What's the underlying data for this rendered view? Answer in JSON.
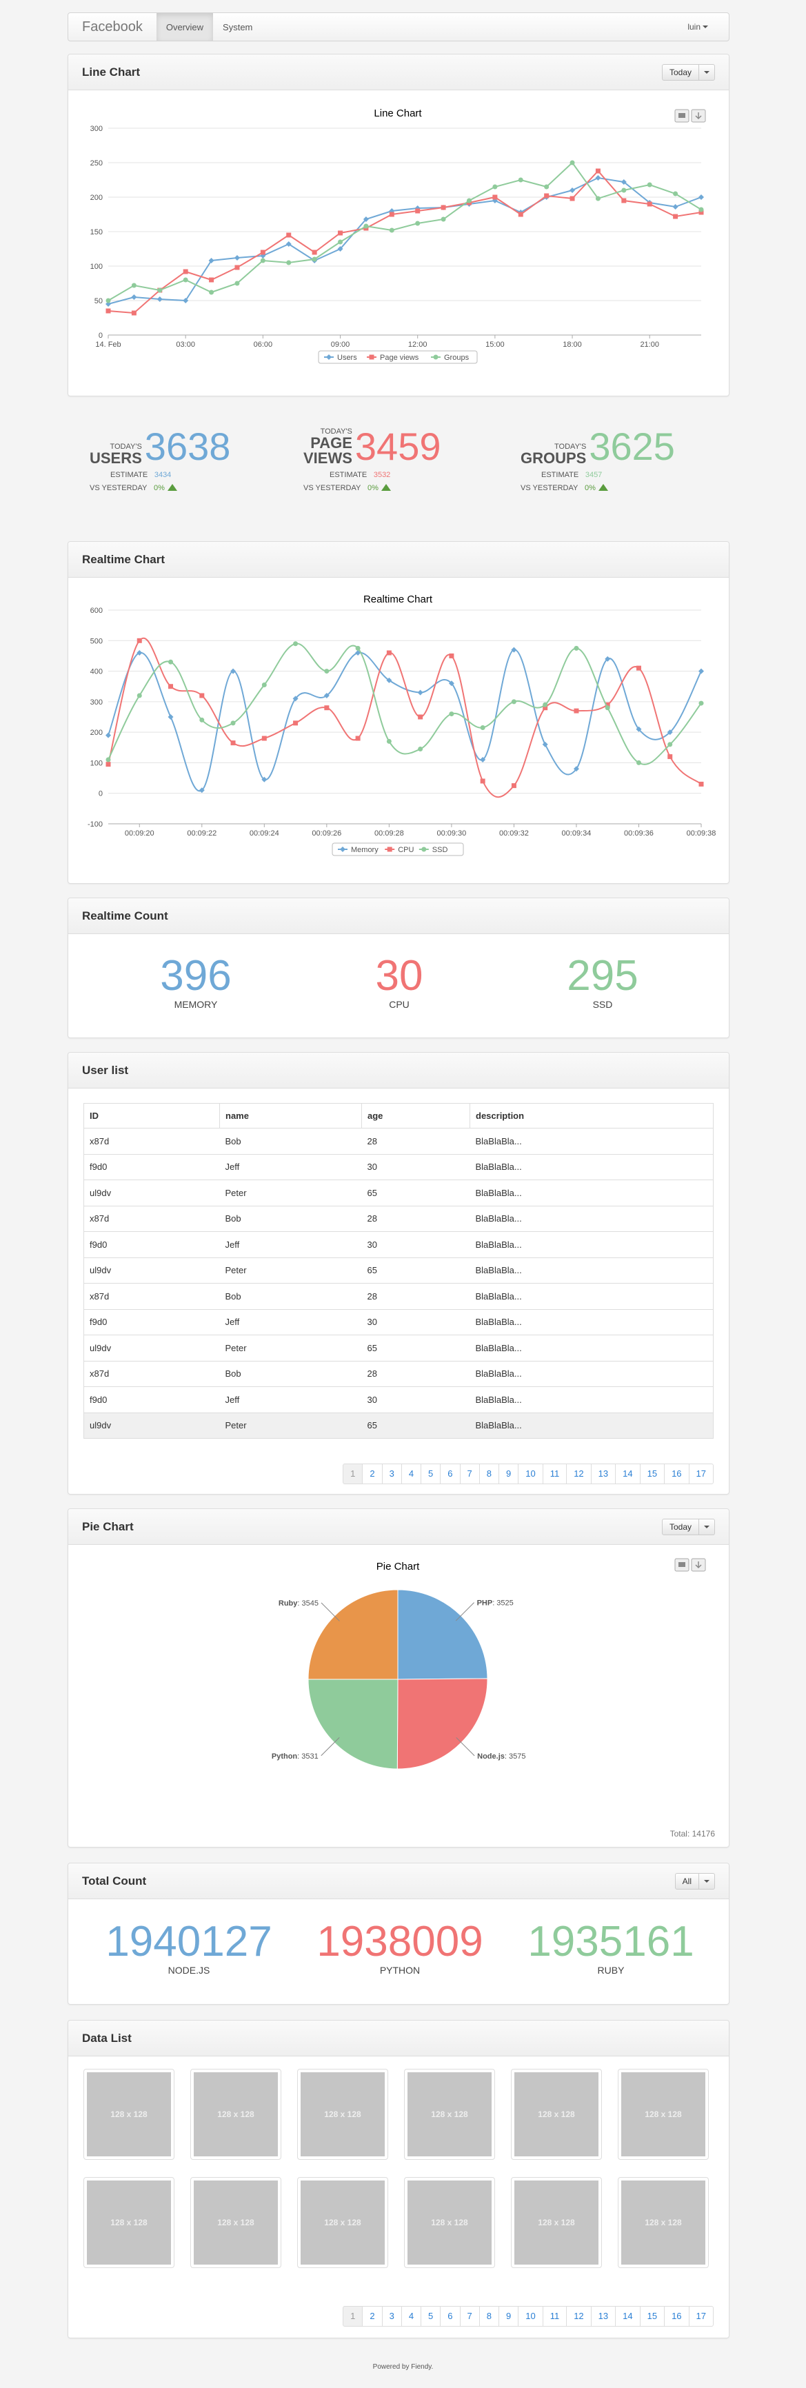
{
  "navbar": {
    "brand": "Facebook",
    "tabs": [
      "Overview",
      "System"
    ],
    "user": "luin"
  },
  "line_panel": {
    "title": "Line Chart",
    "button": "Today"
  },
  "stats": [
    {
      "today": "TODAY'S",
      "label": "USERS",
      "value": "3638",
      "estimate_label": "ESTIMATE",
      "estimate": "3434",
      "vs_label": "VS YESTERDAY",
      "pct": "0%",
      "color": "#6fa8d6"
    },
    {
      "today": "TODAY'S",
      "label": "PAGE VIEWS",
      "value": "3459",
      "estimate_label": "ESTIMATE",
      "estimate": "3532",
      "vs_label": "VS YESTERDAY",
      "pct": "0%",
      "color": "#f07474"
    },
    {
      "today": "TODAY'S",
      "label": "GROUPS",
      "value": "3625",
      "estimate_label": "ESTIMATE",
      "estimate": "3457",
      "vs_label": "VS YESTERDAY",
      "pct": "0%",
      "color": "#8fcb9b"
    }
  ],
  "realtime_panel": {
    "title": "Realtime Chart"
  },
  "realtime_count": {
    "title": "Realtime Count",
    "items": [
      {
        "value": "396",
        "label": "MEMORY",
        "color": "#6fa8d6"
      },
      {
        "value": "30",
        "label": "CPU",
        "color": "#f07474"
      },
      {
        "value": "295",
        "label": "SSD",
        "color": "#8fcb9b"
      }
    ]
  },
  "user_list": {
    "title": "User list",
    "columns": [
      "ID",
      "name",
      "age",
      "description"
    ],
    "rows": [
      [
        "x87d",
        "Bob",
        "28",
        "BlaBlaBla..."
      ],
      [
        "f9d0",
        "Jeff",
        "30",
        "BlaBlaBla..."
      ],
      [
        "ul9dv",
        "Peter",
        "65",
        "BlaBlaBla..."
      ],
      [
        "x87d",
        "Bob",
        "28",
        "BlaBlaBla..."
      ],
      [
        "f9d0",
        "Jeff",
        "30",
        "BlaBlaBla..."
      ],
      [
        "ul9dv",
        "Peter",
        "65",
        "BlaBlaBla..."
      ],
      [
        "x87d",
        "Bob",
        "28",
        "BlaBlaBla..."
      ],
      [
        "f9d0",
        "Jeff",
        "30",
        "BlaBlaBla..."
      ],
      [
        "ul9dv",
        "Peter",
        "65",
        "BlaBlaBla..."
      ],
      [
        "x87d",
        "Bob",
        "28",
        "BlaBlaBla..."
      ],
      [
        "f9d0",
        "Jeff",
        "30",
        "BlaBlaBla..."
      ],
      [
        "ul9dv",
        "Peter",
        "65",
        "BlaBlaBla..."
      ]
    ],
    "pages": [
      "1",
      "2",
      "3",
      "4",
      "5",
      "6",
      "7",
      "8",
      "9",
      "10",
      "11",
      "12",
      "13",
      "14",
      "15",
      "16",
      "17"
    ]
  },
  "pie_panel": {
    "title": "Pie Chart",
    "button": "Today",
    "total": "Total: 14176"
  },
  "total_count": {
    "title": "Total Count",
    "button": "All",
    "items": [
      {
        "value": "1940127",
        "label": "NODE.JS",
        "color": "#6fa8d6"
      },
      {
        "value": "1938009",
        "label": "PYTHON",
        "color": "#f07474"
      },
      {
        "value": "1935161",
        "label": "RUBY",
        "color": "#8fcb9b"
      }
    ]
  },
  "data_list": {
    "title": "Data List",
    "thumb_label": "128 x 128",
    "pages": [
      "1",
      "2",
      "3",
      "4",
      "5",
      "6",
      "7",
      "8",
      "9",
      "10",
      "11",
      "12",
      "13",
      "14",
      "15",
      "16",
      "17"
    ]
  },
  "footer": "Powered by Fiendy.",
  "chart_data": [
    {
      "type": "line",
      "title": "Line Chart",
      "x": [
        "14. Feb",
        "01:00",
        "02:00",
        "03:00",
        "04:00",
        "05:00",
        "06:00",
        "07:00",
        "08:00",
        "09:00",
        "10:00",
        "11:00",
        "12:00",
        "13:00",
        "14:00",
        "15:00",
        "16:00",
        "17:00",
        "18:00",
        "19:00",
        "20:00",
        "21:00",
        "22:00",
        "23:00"
      ],
      "xticks": [
        "14. Feb",
        "03:00",
        "06:00",
        "09:00",
        "12:00",
        "15:00",
        "18:00",
        "21:00"
      ],
      "ylim": [
        0,
        300
      ],
      "yticks": [
        0,
        50,
        100,
        150,
        200,
        250,
        300
      ],
      "series": [
        {
          "name": "Users",
          "color": "#6fa8d6",
          "values": [
            45,
            55,
            52,
            50,
            108,
            112,
            115,
            132,
            108,
            125,
            168,
            180,
            184,
            185,
            190,
            195,
            178,
            200,
            210,
            228,
            222,
            192,
            186,
            200
          ]
        },
        {
          "name": "Page views",
          "color": "#f07474",
          "values": [
            35,
            32,
            65,
            92,
            80,
            98,
            120,
            145,
            120,
            148,
            155,
            175,
            180,
            185,
            192,
            200,
            175,
            202,
            198,
            238,
            195,
            190,
            172,
            178
          ]
        },
        {
          "name": "Groups",
          "color": "#8fcb9b",
          "values": [
            50,
            72,
            65,
            80,
            62,
            75,
            108,
            105,
            110,
            135,
            158,
            152,
            162,
            168,
            195,
            215,
            225,
            215,
            250,
            198,
            210,
            218,
            205,
            182
          ]
        }
      ],
      "legend": "bottom-center"
    },
    {
      "type": "line",
      "title": "Realtime Chart",
      "x": [
        "00:09:19",
        "00:09:20",
        "00:09:21",
        "00:09:22",
        "00:09:23",
        "00:09:24",
        "00:09:25",
        "00:09:26",
        "00:09:27",
        "00:09:28",
        "00:09:29",
        "00:09:30",
        "00:09:31",
        "00:09:32",
        "00:09:33",
        "00:09:34",
        "00:09:35",
        "00:09:36",
        "00:09:37",
        "00:09:38"
      ],
      "xticks": [
        "00:09:20",
        "00:09:22",
        "00:09:24",
        "00:09:26",
        "00:09:28",
        "00:09:30",
        "00:09:32",
        "00:09:34",
        "00:09:36",
        "00:09:38"
      ],
      "ylim": [
        -100,
        600
      ],
      "yticks": [
        -100,
        0,
        100,
        200,
        300,
        400,
        500,
        600
      ],
      "series": [
        {
          "name": "Memory",
          "color": "#6fa8d6",
          "values": [
            190,
            460,
            250,
            10,
            400,
            45,
            310,
            320,
            460,
            370,
            330,
            360,
            110,
            470,
            160,
            80,
            440,
            210,
            200,
            400
          ]
        },
        {
          "name": "CPU",
          "color": "#f07474",
          "values": [
            95,
            500,
            350,
            320,
            165,
            180,
            230,
            280,
            180,
            460,
            250,
            450,
            40,
            25,
            280,
            270,
            290,
            410,
            120,
            30
          ]
        },
        {
          "name": "SSD",
          "color": "#8fcb9b",
          "values": [
            110,
            320,
            430,
            240,
            230,
            355,
            490,
            400,
            475,
            170,
            145,
            260,
            215,
            300,
            290,
            475,
            280,
            100,
            160,
            295
          ]
        }
      ],
      "legend": "bottom-center"
    },
    {
      "type": "pie",
      "title": "Pie Chart",
      "slices": [
        {
          "name": "PHP",
          "value": 3525,
          "color": "#6fa8d6"
        },
        {
          "name": "Node.js",
          "value": 3575,
          "color": "#f07474"
        },
        {
          "name": "Python",
          "value": 3531,
          "color": "#8fcb9b"
        },
        {
          "name": "Ruby",
          "value": 3545,
          "color": "#e8954a"
        }
      ]
    }
  ]
}
